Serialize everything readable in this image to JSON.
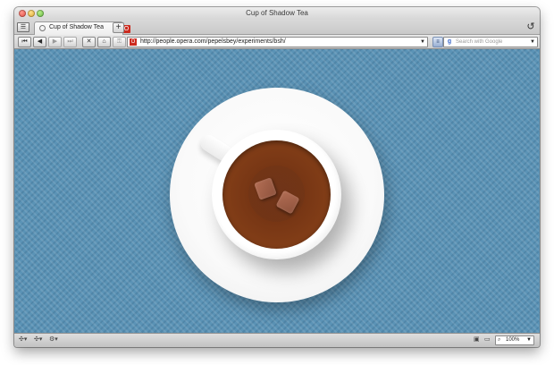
{
  "window": {
    "title": "Cup of Shadow Tea"
  },
  "tab_bar": {
    "tabs": [
      {
        "title": "Cup of Shadow Tea"
      }
    ],
    "new_tab_label": "+",
    "panel_label": "☰",
    "opera_badge": "O",
    "closed_tabs_icon": "↺"
  },
  "toolbar": {
    "address": "http://people.opera.com/pepelsbey/experiments/bsh/",
    "dropdown_arrow": "▼",
    "search_placeholder": "Search with Google",
    "search_engine_glyph": "g",
    "buttons": {
      "rewind": "⏮",
      "back": "◀",
      "forward": "▶",
      "fast_forward": "⏭",
      "stop": "✕",
      "home": "⌂",
      "wand": "⚿",
      "rss": "≡"
    }
  },
  "status_bar": {
    "zoom": "100%",
    "zoom_dropdown": "▼",
    "left_icons": [
      "✣▾",
      "✣▾",
      "⚙▾"
    ],
    "right_icons": [
      "▣",
      "▭"
    ],
    "zoom_icon": "⌕"
  },
  "colors": {
    "page_background": "#5b93b6",
    "tea": "#7a3815",
    "saucer": "#ffffff"
  },
  "icons": {
    "close": "traffic-close-icon",
    "minimize": "traffic-minimize-icon",
    "maximize": "traffic-maximize-icon"
  }
}
